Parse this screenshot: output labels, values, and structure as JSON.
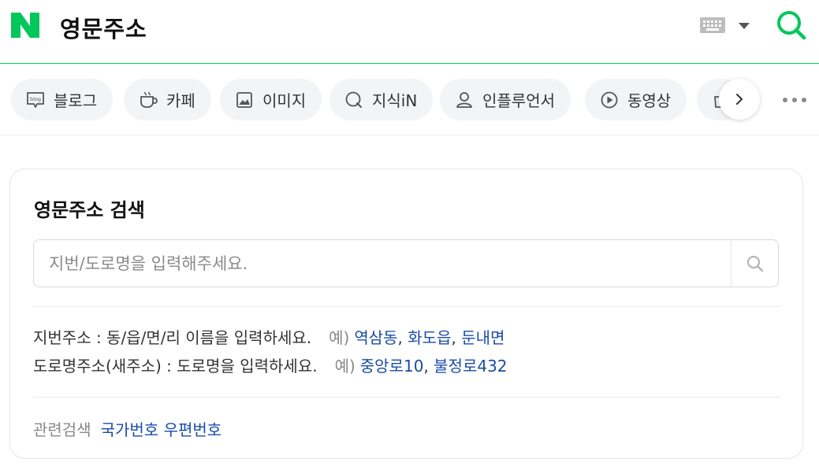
{
  "header": {
    "query": "영문주소",
    "logo_icon": "naver-n-logo-icon",
    "brand_color": "#03c75a"
  },
  "tabs": [
    {
      "label": "블로그",
      "icon": "blog-icon"
    },
    {
      "label": "카페",
      "icon": "cafe-icon"
    },
    {
      "label": "이미지",
      "icon": "image-icon"
    },
    {
      "label": "지식iN",
      "icon": "kin-icon"
    },
    {
      "label": "인플루언서",
      "icon": "influencer-icon"
    },
    {
      "label": "동영상",
      "icon": "video-icon"
    }
  ],
  "card": {
    "title": "영문주소 검색",
    "search": {
      "placeholder": "지번/도로명을 입력해주세요.",
      "value": ""
    },
    "guides": [
      {
        "text": "지번주소 : 동/읍/면/리 이름을 입력하세요.",
        "example_label": "예)",
        "examples": [
          "역삼동",
          "화도읍",
          "둔내면"
        ]
      },
      {
        "text": "도로명주소(새주소) : 도로명을 입력하세요.",
        "example_label": "예)",
        "examples": [
          "중앙로10",
          "불정로432"
        ]
      }
    ],
    "related": {
      "label": "관련검색",
      "links": [
        "국가번호",
        "우편번호"
      ]
    }
  },
  "colors": {
    "link": "#1a4ca8",
    "tab_bg": "#f3f4f6"
  }
}
